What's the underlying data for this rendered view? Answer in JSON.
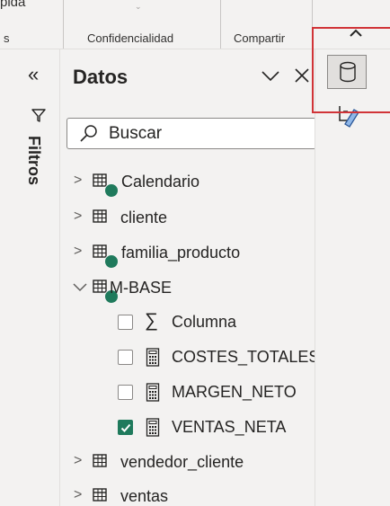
{
  "ribbon": {
    "partial_top": "pida",
    "left_fragment": "s",
    "confidencialidad": "Confidencialidad",
    "compartir": "Compartir"
  },
  "filters": {
    "label": "Filtros"
  },
  "data_pane": {
    "title": "Datos",
    "search_placeholder": "Buscar",
    "tables": [
      {
        "label": "Calendario"
      },
      {
        "label": "cliente"
      },
      {
        "label": "familia_producto"
      },
      {
        "label": "M-BASE",
        "fields": [
          {
            "label": "Columna",
            "checked": false,
            "icon": "sigma-icon"
          },
          {
            "label": "COSTES_TOTALES",
            "checked": false,
            "icon": "calculator-icon"
          },
          {
            "label": "MARGEN_NETO",
            "checked": false,
            "icon": "calculator-icon"
          },
          {
            "label": "VENTAS_NETA",
            "checked": true,
            "icon": "calculator-icon"
          }
        ]
      },
      {
        "label": "vendedor_cliente"
      },
      {
        "label": "ventas"
      }
    ]
  },
  "colors": {
    "accent_red": "#d13438",
    "check_green": "#1f7a5c"
  }
}
